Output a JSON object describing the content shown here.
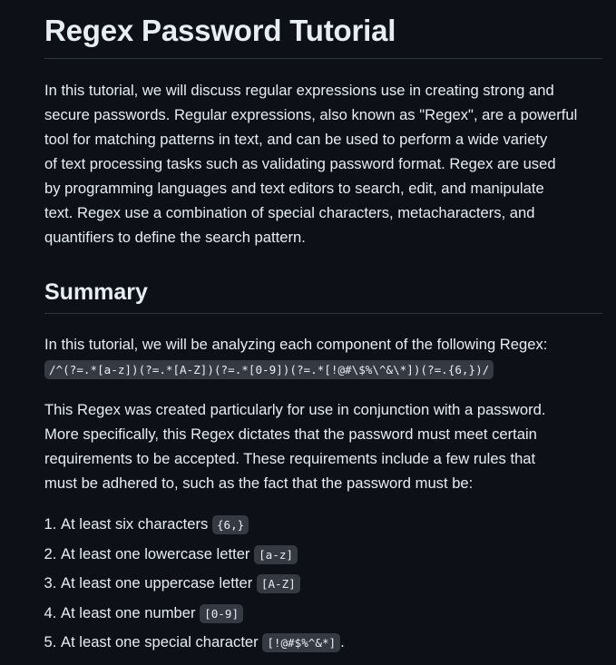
{
  "title": "Regex Password Tutorial",
  "intro_lines": [
    "In this tutorial, we will discuss regular expressions use in creating strong and",
    "secure passwords. Regular expressions, also known as \"Regex\", are a powerful",
    "tool for matching patterns in text, and can be used to perform a wide variety",
    "of text processing tasks such as validating password format. Regex are used",
    "by programming languages and text editors to search, edit, and manipulate",
    "text. Regex use a combination of special characters, metacharacters, and",
    "quantifiers to define the search pattern."
  ],
  "summary": {
    "heading": "Summary",
    "lead": "In this tutorial, we will be analyzing each component of the following Regex:",
    "regex": "/^(?=.*[a-z])(?=.*[A-Z])(?=.*[0-9])(?=.*[!@#\\$%\\^&\\*])(?=.{6,})/",
    "desc_lines": [
      "This Regex was created particularly for use in conjunction with a password.",
      "More specifically, this Regex dictates that the password must meet certain",
      "requirements to be accepted. These requirements include a few rules that",
      "must be adhered to, such as the fact that the password must be:"
    ],
    "rules": [
      {
        "text": "At least six characters",
        "code": "{6,}",
        "suffix": ""
      },
      {
        "text": "At least one lowercase letter",
        "code": "[a-z]",
        "suffix": ""
      },
      {
        "text": "At least one uppercase letter",
        "code": "[A-Z]",
        "suffix": ""
      },
      {
        "text": "At least one number",
        "code": "[0-9]",
        "suffix": ""
      },
      {
        "text": "At least one special character",
        "code": "[!@#$%^&*]",
        "suffix": "."
      }
    ]
  }
}
